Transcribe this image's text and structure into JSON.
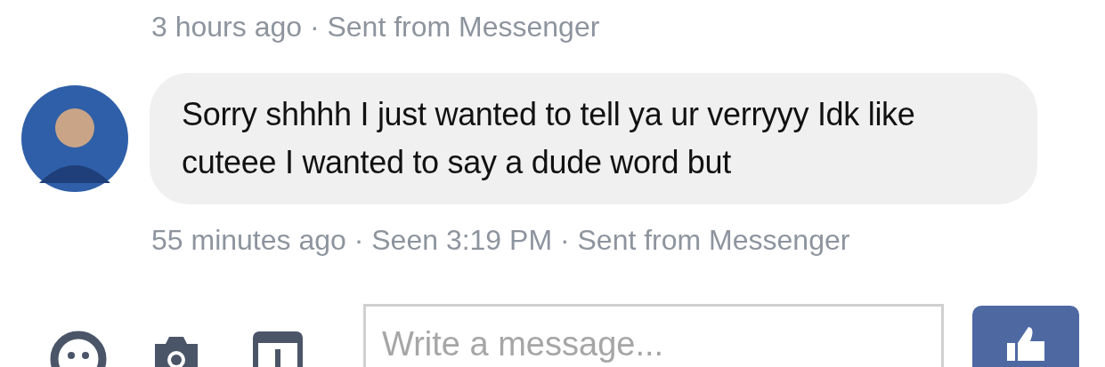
{
  "messages": [
    {
      "meta": "3 hours ago · Sent from Messenger"
    },
    {
      "text": "Sorry shhhh I just wanted to tell ya ur verryyy Idk like cuteee I wanted to say a dude word but",
      "meta": "55 minutes ago · Seen 3:19 PM · Sent from Messenger"
    }
  ],
  "composer": {
    "placeholder": "Write a message..."
  }
}
